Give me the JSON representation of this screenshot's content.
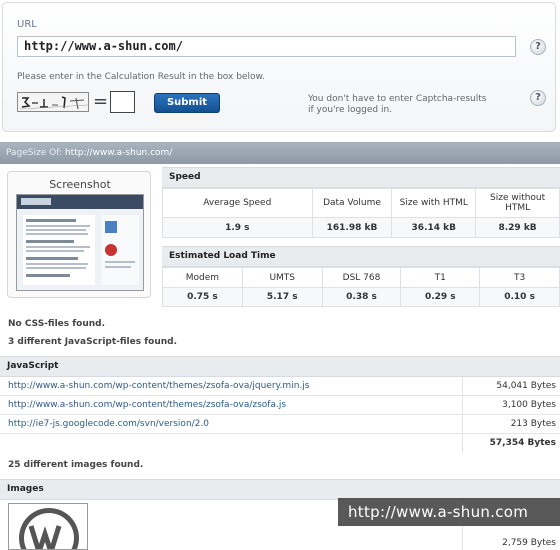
{
  "form": {
    "url_label": "URL",
    "url_value": "http://www.a-shun.com/",
    "help_glyph": "?",
    "calc_hint": "Please enter in the Calculation Result in the box below.",
    "equals": "=",
    "submit_label": "Submit",
    "captcha_note_line1": "You don't have to enter Captcha-results",
    "captcha_note_line2": "if you're logged in."
  },
  "pagesize": {
    "label": "PageSize Of:",
    "url": "http://www.a-shun.com/"
  },
  "screenshot": {
    "title": "Screenshot"
  },
  "speed": {
    "header": "Speed",
    "columns": [
      "Average Speed",
      "Data Volume",
      "Size with HTML",
      "Size without HTML"
    ],
    "values": [
      "1.9 s",
      "161.98 kB",
      "36.14 kB",
      "8.29 kB"
    ]
  },
  "load_time": {
    "header": "Estimated Load Time",
    "columns": [
      "Modem",
      "UMTS",
      "DSL 768",
      "T1",
      "T3"
    ],
    "values": [
      "0.75 s",
      "5.17 s",
      "0.38 s",
      "0.29 s",
      "0.10 s"
    ]
  },
  "notes": {
    "no_css": "No CSS-files found.",
    "js_count": "3 different JavaScript-files found.",
    "images_count": "25 different images found."
  },
  "javascript": {
    "header": "JavaScript",
    "files": [
      {
        "url": "http://www.a-shun.com/wp-content/themes/zsofa-ova/jquery.min.js",
        "size": "54,041 Bytes"
      },
      {
        "url": "http://www.a-shun.com/wp-content/themes/zsofa-ova/zsofa.js",
        "size": "3,100 Bytes"
      },
      {
        "url": "http://ie7-js.googlecode.com/svn/version/2.0",
        "size": "213 Bytes"
      }
    ],
    "total": "57,354 Bytes"
  },
  "images": {
    "header": "Images",
    "first_size": "2,759 Bytes"
  },
  "watermark": "http://www.a-shun.com",
  "colors": {
    "accent_blue": "#12508f",
    "header_bar": "#97a4b0",
    "link": "#2e5a8a"
  }
}
